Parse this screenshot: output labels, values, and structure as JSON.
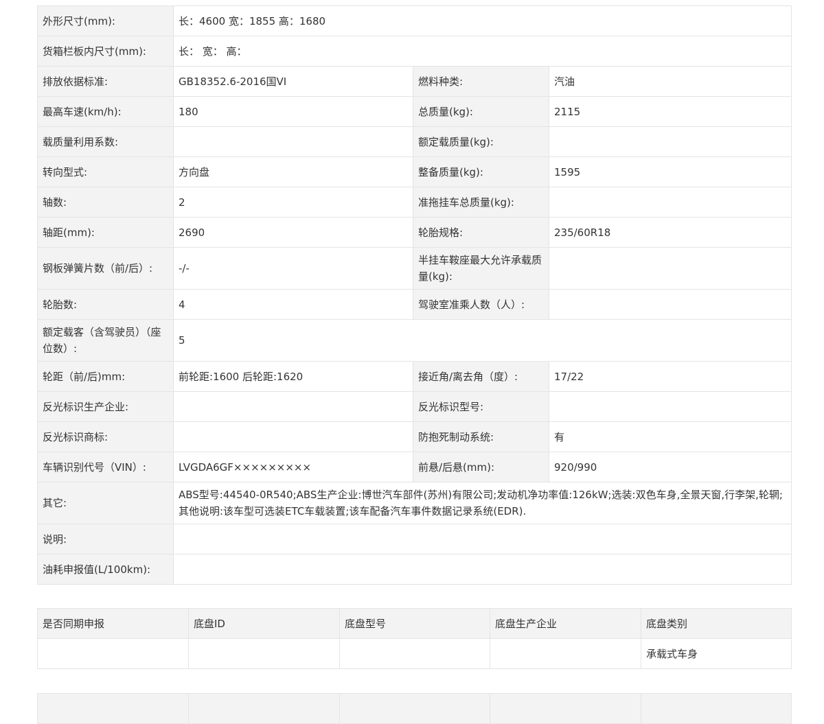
{
  "spec": {
    "dims_label": "外形尺寸(mm):",
    "dims_value": "长：4600 宽：1855 高：1680",
    "cargo_label": "货箱栏板内尺寸(mm):",
    "cargo_value": "长： 宽： 高：",
    "emission_label": "排放依据标准:",
    "emission_value": "GB18352.6-2016国VI",
    "fuel_label": "燃料种类:",
    "fuel_value": "汽油",
    "speed_label": "最高车速(km/h):",
    "speed_value": "180",
    "gross_label": "总质量(kg):",
    "gross_value": "2115",
    "load_coef_label": "载质量利用系数:",
    "load_coef_value": "",
    "rated_load_label": "额定载质量(kg):",
    "rated_load_value": "",
    "steering_label": "转向型式:",
    "steering_value": "方向盘",
    "curb_label": "整备质量(kg):",
    "curb_value": "1595",
    "axles_label": "轴数:",
    "axles_value": "2",
    "tow_label": "准拖挂车总质量(kg):",
    "tow_value": "",
    "wheelbase_label": "轴距(mm):",
    "wheelbase_value": "2690",
    "tire_spec_label": "轮胎规格:",
    "tire_spec_value": "235/60R18",
    "spring_label": "钢板弹簧片数（前/后）:",
    "spring_value": "-/-",
    "saddle_label": "半挂车鞍座最大允许承载质量(kg):",
    "saddle_value": "",
    "tires_label": "轮胎数:",
    "tires_value": "4",
    "cab_label": "驾驶室准乘人数（人）:",
    "cab_value": "",
    "seats_label": "额定载客（含驾驶员）（座位数）:",
    "seats_value": "5",
    "track_label": "轮距（前/后)mm:",
    "track_value": "前轮距:1600 后轮距:1620",
    "angle_label": "接近角/离去角（度）:",
    "angle_value": "17/22",
    "reflect_maker_label": "反光标识生产企业:",
    "reflect_maker_value": "",
    "reflect_model_label": "反光标识型号:",
    "reflect_model_value": "",
    "reflect_brand_label": "反光标识商标:",
    "reflect_brand_value": "",
    "abs_label": "防抱死制动系统:",
    "abs_value": "有",
    "vin_label": "车辆识别代号（VIN）:",
    "vin_value": "LVGDA6GF×××××××××",
    "overhang_label": "前悬/后悬(mm):",
    "overhang_value": "920/990",
    "other_label": "其它:",
    "other_value": "ABS型号:44540-0R540;ABS生产企业:博世汽车部件(苏州)有限公司;发动机净功率值:126kW;选装:双色车身,全景天窗,行李架,轮辋;其他说明:该车型可选装ETC车载装置;该车配备汽车事件数据记录系统(EDR).",
    "note_label": "说明:",
    "note_value": "",
    "fuel_cons_label": "油耗申报值(L/100km):",
    "fuel_cons_value": ""
  },
  "chassis": {
    "headers": [
      "是否同期申报",
      "底盘ID",
      "底盘型号",
      "底盘生产企业",
      "底盘类别"
    ],
    "row": [
      "",
      "",
      "",
      "",
      "承载式车身"
    ]
  }
}
